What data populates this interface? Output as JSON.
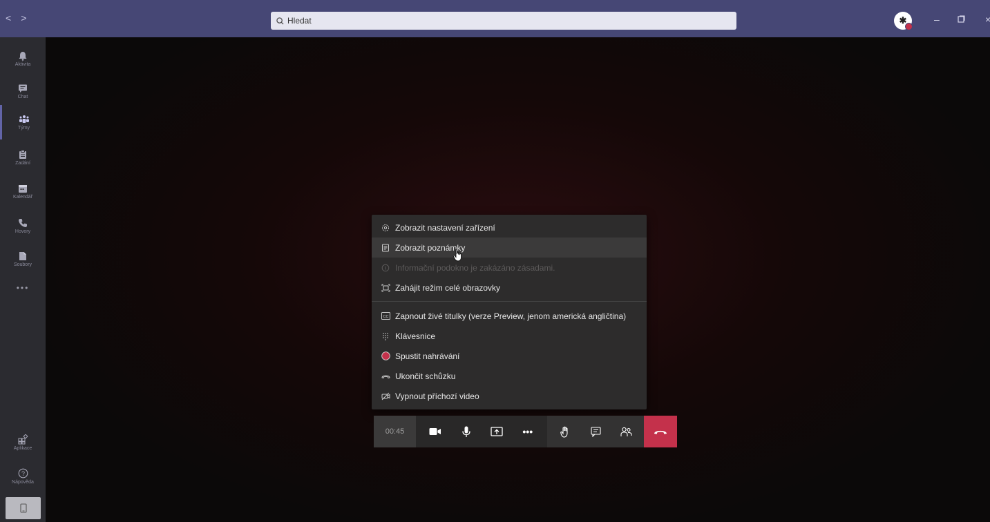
{
  "search": {
    "placeholder": "Hledat"
  },
  "nav": {
    "back": "<",
    "forward": ">"
  },
  "rail": {
    "items": [
      {
        "label": "Aktivita",
        "icon": "bell-icon"
      },
      {
        "label": "Chat",
        "icon": "chat-icon"
      },
      {
        "label": "Týmy",
        "icon": "teams-icon",
        "active": true
      },
      {
        "label": "Zadání",
        "icon": "assignments-icon"
      },
      {
        "label": "Kalendář",
        "icon": "calendar-icon"
      },
      {
        "label": "Hovory",
        "icon": "phone-icon"
      },
      {
        "label": "Soubory",
        "icon": "files-icon"
      }
    ],
    "more": "•••",
    "bottom": [
      {
        "label": "Aplikace",
        "icon": "apps-icon"
      },
      {
        "label": "Nápověda",
        "icon": "help-icon"
      }
    ]
  },
  "menu": {
    "items": [
      {
        "label": "Zobrazit nastavení zařízení",
        "icon": "settings-icon"
      },
      {
        "label": "Zobrazit poznámky",
        "icon": "notes-icon",
        "hover": true
      },
      {
        "label": "Informační podokno je zakázáno zásadami.",
        "icon": "info-icon",
        "disabled": true
      },
      {
        "label": "Zahájit režim celé obrazovky",
        "icon": "fullscreen-icon"
      },
      {
        "label": "Zapnout živé titulky (verze Preview, jenom americká angličtina)",
        "icon": "captions-icon"
      },
      {
        "label": "Klávesnice",
        "icon": "keypad-icon"
      },
      {
        "label": "Spustit nahrávání",
        "icon": "record-icon"
      },
      {
        "label": "Ukončit schůzku",
        "icon": "end-meeting-icon"
      },
      {
        "label": "Vypnout příchozí video",
        "icon": "video-off-icon"
      }
    ]
  },
  "callbar": {
    "timer": "00:45",
    "more_label": "•••"
  },
  "colors": {
    "topbar": "#464775",
    "rail": "#2b2b30",
    "hangup": "#c4314b",
    "accent": "#6264a7"
  }
}
